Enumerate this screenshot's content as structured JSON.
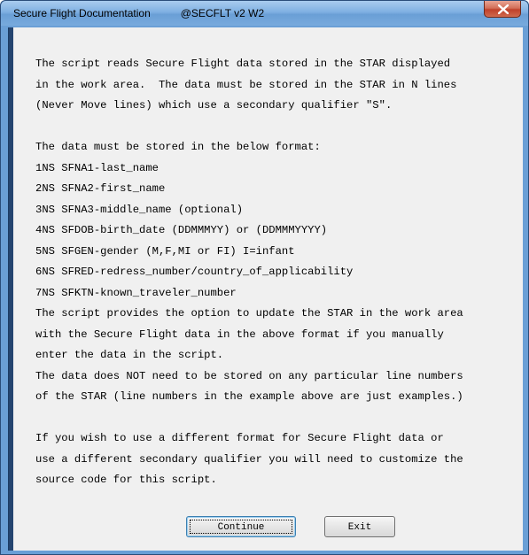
{
  "window": {
    "title": "Secure Flight Documentation",
    "subtitle": "@SECFLT v2 W2",
    "close_icon": "close-x-icon"
  },
  "document": {
    "lines": [
      "The script reads Secure Flight data stored in the STAR displayed",
      "in the work area.  The data must be stored in the STAR in N lines",
      "(Never Move lines) which use a secondary qualifier \"S\".",
      "",
      "The data must be stored in the below format:",
      "1NS SFNA1-last_name",
      "2NS SFNA2-first_name",
      "3NS SFNA3-middle_name (optional)",
      "4NS SFDOB-birth_date (DDMMMYY) or (DDMMMYYYY)",
      "5NS SFGEN-gender (M,F,MI or FI) I=infant",
      "6NS SFRED-redress_number/country_of_applicability",
      "7NS SFKTN-known_traveler_number",
      "The script provides the option to update the STAR in the work area",
      "with the Secure Flight data in the above format if you manually",
      "enter the data in the script.",
      "The data does NOT need to be stored on any particular line numbers",
      "of the STAR (line numbers in the example above are just examples.)",
      "",
      "If you wish to use a different format for Secure Flight data or",
      "use a different secondary qualifier you will need to customize the",
      "source code for this script."
    ]
  },
  "buttons": {
    "continue_label": "Continue",
    "exit_label": "Exit"
  },
  "colors": {
    "title_bar": "#6a9fd6",
    "close_button": "#c0412a",
    "dialog_background": "#f0f0f0"
  }
}
